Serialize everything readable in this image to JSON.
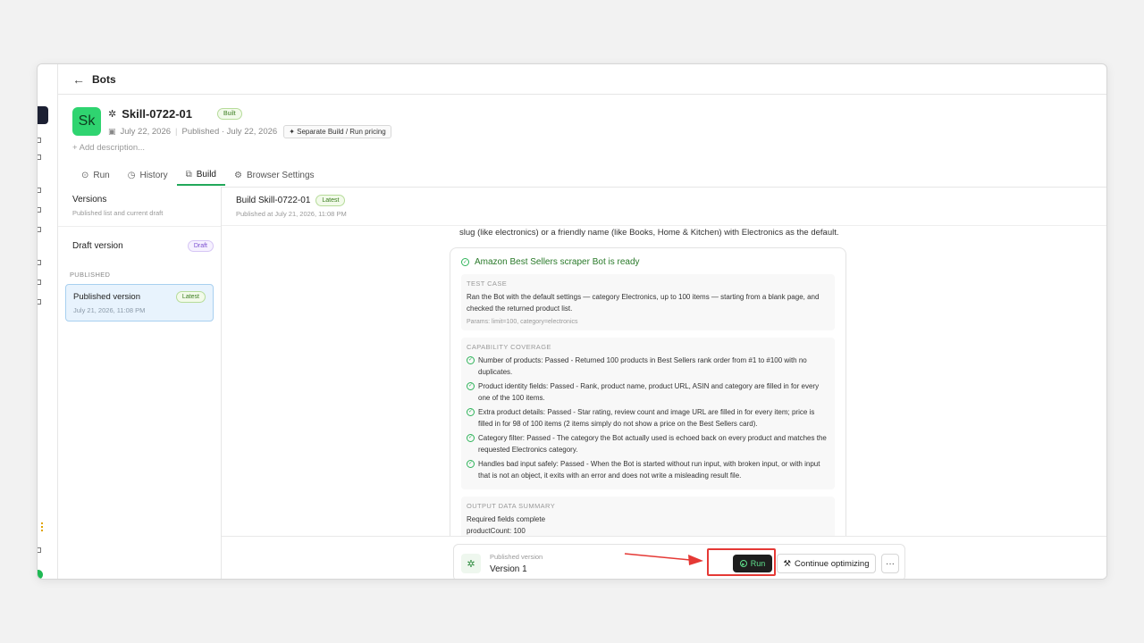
{
  "topbar": {
    "back_label": "Bots"
  },
  "skill": {
    "avatar": "Sk",
    "name": "Skill-0722-01",
    "status_badge": "Built",
    "created_date": "July 22, 2026",
    "published_text": "Published · July 22, 2026",
    "pricing_label": "Separate Build / Run pricing",
    "add_description": "+ Add description..."
  },
  "tabs": [
    {
      "label": "Run",
      "icon": "play-circle-icon"
    },
    {
      "label": "History",
      "icon": "clock-icon"
    },
    {
      "label": "Build",
      "icon": "build-icon",
      "active": true
    },
    {
      "label": "Browser Settings",
      "icon": "gear-icon"
    }
  ],
  "sidebar": {
    "title": "Versions",
    "subtitle": "Published list and current draft",
    "draft_label": "Draft version",
    "draft_badge": "Draft",
    "published_heading": "PUBLISHED",
    "published_item": {
      "name": "Published version",
      "date": "July 21, 2026, 11:08 PM",
      "badge": "Latest"
    }
  },
  "main": {
    "build_title": "Build Skill-0722-01",
    "build_badge": "Latest",
    "build_sub": "Published at July 21, 2026, 11:08 PM",
    "prose": "slug (like electronics) or a friendly name (like Books, Home & Kitchen) with Electronics as the default.",
    "report": {
      "title": "Amazon Best Sellers scraper Bot is ready",
      "test_case": {
        "heading": "TEST CASE",
        "text": "Ran the Bot with the default settings — category Electronics, up to 100 items — starting from a blank page, and checked the returned product list.",
        "params": "Params: limit=100, category=electronics"
      },
      "coverage": {
        "heading": "CAPABILITY COVERAGE",
        "items": [
          "Number of products: Passed - Returned 100 products in Best Sellers rank order from #1 to #100 with no duplicates.",
          "Product identity fields: Passed - Rank, product name, product URL, ASIN and category are filled in for every one of the 100 items.",
          "Extra product details: Passed - Star rating, review count and image URL are filled in for every item; price is filled in for 98 of 100 items (2 items simply do not show a price on the Best Sellers card).",
          "Category filter: Passed - The category the Bot actually used is echoed back on every product and matches the requested Electronics category.",
          "Handles bad input safely: Passed - When the Bot is started without run input, with broken input, or with input that is not an object, it exits with an error and does not write a misleading result file."
        ]
      },
      "output": {
        "heading": "OUTPUT DATA SUMMARY",
        "lines": [
          "Required fields complete",
          "productCount: 100"
        ]
      }
    }
  },
  "bottom_bar": {
    "label": "Published version",
    "version": "Version 1",
    "run_label": "Run",
    "continue_label": "Continue optimizing",
    "more_label": "···"
  },
  "colors": {
    "accent_green": "#22a85a",
    "highlight_red": "#e53935",
    "avatar_green": "#2fd470"
  }
}
